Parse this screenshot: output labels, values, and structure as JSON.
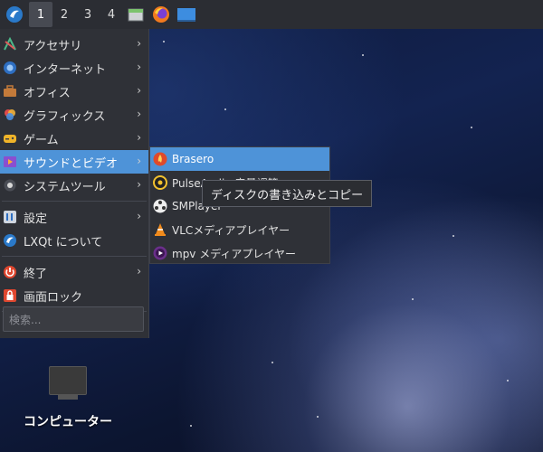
{
  "taskbar": {
    "workspaces": [
      "1",
      "2",
      "3",
      "4"
    ],
    "active_workspace": "1",
    "apps": [
      "file-manager-icon",
      "firefox-icon",
      "show-desktop-icon"
    ]
  },
  "menu": {
    "items": [
      {
        "label": "アクセサリ",
        "icon": "accessories-icon",
        "submenu": true
      },
      {
        "label": "インターネット",
        "icon": "internet-icon",
        "submenu": true
      },
      {
        "label": "オフィス",
        "icon": "office-icon",
        "submenu": true
      },
      {
        "label": "グラフィックス",
        "icon": "graphics-icon",
        "submenu": true
      },
      {
        "label": "ゲーム",
        "icon": "games-icon",
        "submenu": true
      },
      {
        "label": "サウンドとビデオ",
        "icon": "sound-video-icon",
        "submenu": true,
        "highlighted": true
      },
      {
        "label": "システムツール",
        "icon": "system-tools-icon",
        "submenu": true
      },
      {
        "label": "設定",
        "icon": "settings-icon",
        "submenu": true
      },
      {
        "label": "LXQt について",
        "icon": "lxqt-icon",
        "submenu": false
      },
      {
        "label": "終了",
        "icon": "power-icon",
        "submenu": true
      },
      {
        "label": "画面ロック",
        "icon": "lock-icon",
        "submenu": false
      }
    ],
    "search_placeholder": "検索..."
  },
  "submenu": {
    "items": [
      {
        "label": "Brasero",
        "icon": "brasero-icon",
        "highlighted": true
      },
      {
        "label": "PulseAudio 音量調節 ",
        "icon": "pulseaudio-icon"
      },
      {
        "label": "SMPlayer",
        "icon": "smplayer-icon"
      },
      {
        "label": "VLCメディアプレイヤー",
        "icon": "vlc-icon"
      },
      {
        "label": "mpv メディアプレイヤー",
        "icon": "mpv-icon"
      }
    ]
  },
  "tooltip": "ディスクの書き込みとコピー",
  "desktop": {
    "computer_label": "コンピューター"
  },
  "colors": {
    "highlight": "#4e93d8",
    "menu_bg": "#2f3137",
    "taskbar_bg": "#2b2d33"
  }
}
